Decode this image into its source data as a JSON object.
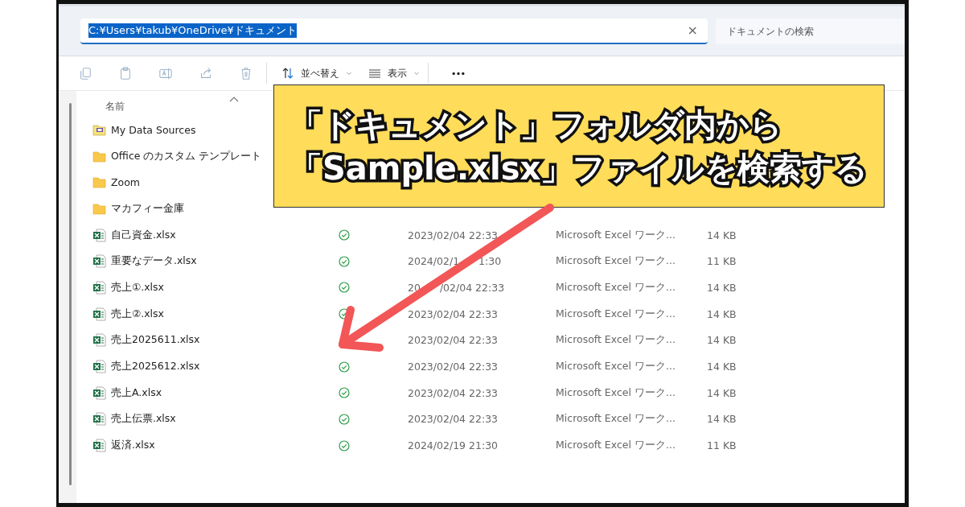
{
  "address_bar": {
    "path": "C:¥Users¥takub¥OneDrive¥ドキュメント",
    "selected": true,
    "clear": "×"
  },
  "search": {
    "placeholder": "ドキュメントの検索"
  },
  "toolbar": {
    "icons": [
      {
        "kind": "copy",
        "disabled": true
      },
      {
        "kind": "paste",
        "disabled": true
      },
      {
        "kind": "rename",
        "disabled": true
      },
      {
        "kind": "share",
        "disabled": true
      },
      {
        "kind": "delete",
        "disabled": true
      }
    ],
    "sort": "並べ替え",
    "view": "表示"
  },
  "columns": {
    "name": "名前"
  },
  "rows": [
    {
      "name": "My Data Sources",
      "kind": "datasource"
    },
    {
      "name": "Office のカスタム テンプレート",
      "kind": "folder"
    },
    {
      "name": "Zoom",
      "kind": "folder"
    },
    {
      "name": "マカフィー金庫",
      "kind": "folder"
    },
    {
      "name": "自己資金.xlsx",
      "kind": "excel",
      "synced": true,
      "date": "2023/02/04 22:33",
      "type": "Microsoft Excel ワーク...",
      "size": "14 KB"
    },
    {
      "name": "重要なデータ.xlsx",
      "kind": "excel",
      "synced": true,
      "date": [
        "2024/02/1",
        "1:30"
      ],
      "type": "Microsoft Excel ワーク...",
      "size": "11 KB"
    },
    {
      "name": "売上①.xlsx",
      "kind": "excel",
      "synced": true,
      "date": [
        "20",
        "/02/04 22:33"
      ],
      "type": "Microsoft Excel ワーク...",
      "size": "14 KB"
    },
    {
      "name": "売上②.xlsx",
      "kind": "excel",
      "synced": true,
      "date": "2023/02/04 22:33",
      "type": "Microsoft Excel ワーク...",
      "size": "14 KB"
    },
    {
      "name": "売上2025611.xlsx",
      "kind": "excel",
      "date": "2023/02/04 22:33",
      "type": "Microsoft Excel ワーク...",
      "size": "14 KB"
    },
    {
      "name": "売上2025612.xlsx",
      "kind": "excel",
      "synced": true,
      "date": "2023/02/04 22:33",
      "type": "Microsoft Excel ワーク...",
      "size": "14 KB"
    },
    {
      "name": "売上A.xlsx",
      "kind": "excel",
      "synced": true,
      "date": "2023/02/04 22:33",
      "type": "Microsoft Excel ワーク...",
      "size": "14 KB"
    },
    {
      "name": "売上伝票.xlsx",
      "kind": "excel",
      "synced": true,
      "date": "2023/02/04 22:33",
      "type": "Microsoft Excel ワーク...",
      "size": "14 KB"
    },
    {
      "name": "返済.xlsx",
      "kind": "excel",
      "synced": true,
      "date": "2024/02/19 21:30",
      "type": "Microsoft Excel ワーク...",
      "size": "11 KB"
    }
  ],
  "callout": {
    "lines": [
      "「ドキュメント」フォルダ内から",
      "「Sample.xlsx」ファイルを検索する"
    ]
  }
}
